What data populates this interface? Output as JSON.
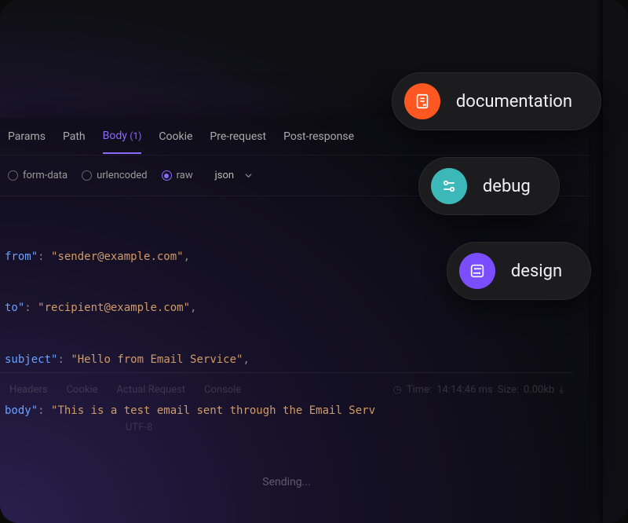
{
  "tabs": {
    "params": "Params",
    "path": "Path",
    "body": "Body",
    "body_count": "(1)",
    "cookie": "Cookie",
    "pre_request": "Pre-request",
    "post_response": "Post-response"
  },
  "body_types": {
    "form_data": "form-data",
    "urlencoded": "urlencoded",
    "raw": "raw",
    "format_selected": "json"
  },
  "code": [
    {
      "key": "from",
      "value": "\"sender@example.com\""
    },
    {
      "key": "to",
      "value": "\"recipient@example.com\""
    },
    {
      "key": "subject",
      "value": "\"Hello from Email Service\""
    },
    {
      "key": "body",
      "value": "\"This is a test email sent through the Email Serv"
    }
  ],
  "bottom_tabs": {
    "headers": "Headers",
    "cookie": "Cookie",
    "actual_request": "Actual Request",
    "console": "Console",
    "time_label": "Time:",
    "time_value": "14:14:46 ms",
    "size_label": "Size:",
    "size_value": "0.00kb"
  },
  "encoding": "UTF-8",
  "sending": "Sending...",
  "pills": {
    "documentation": "documentation",
    "debug": "debug",
    "design": "design"
  },
  "colors": {
    "accent": "#8a6aff",
    "doc": "#ff5722",
    "debug": "#3db8b8",
    "design": "#7a4dff"
  }
}
